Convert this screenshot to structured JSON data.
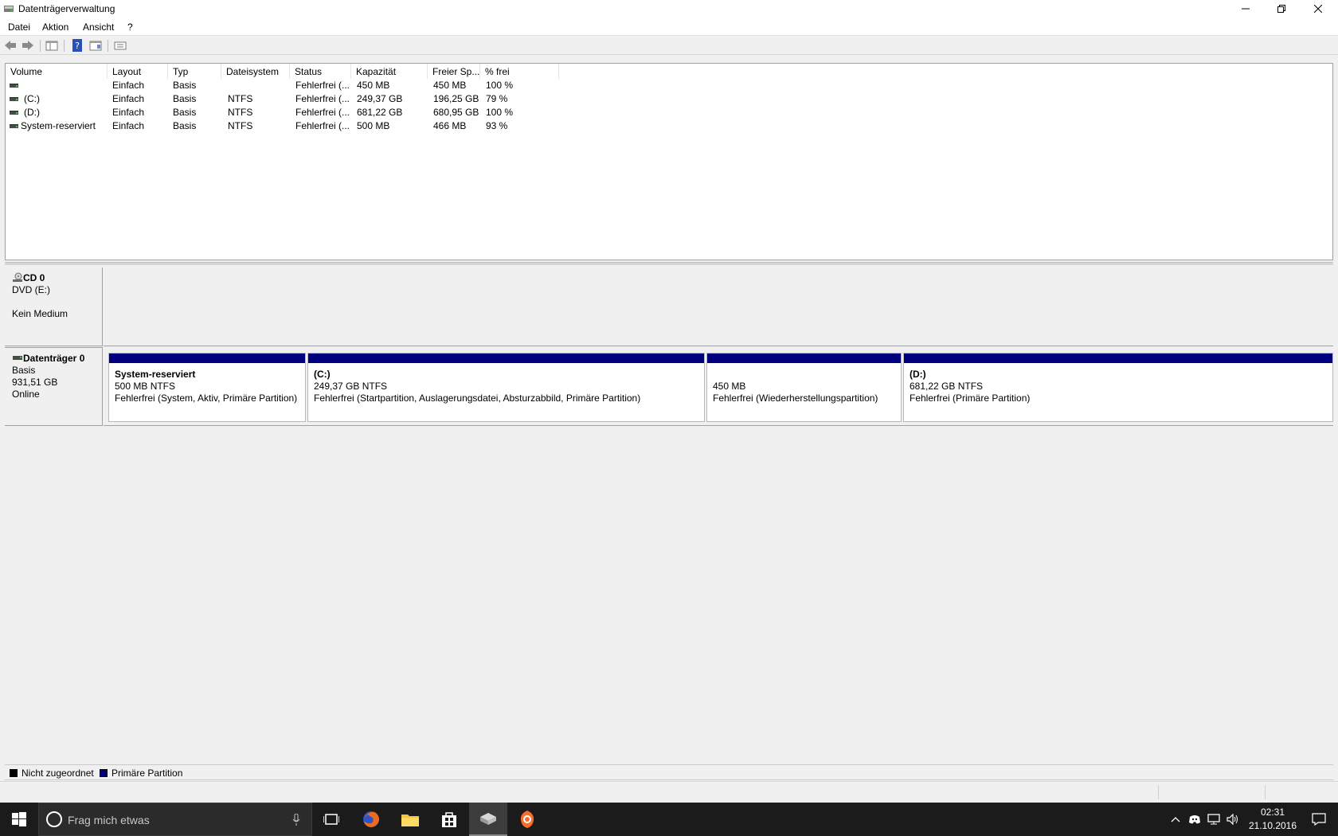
{
  "window": {
    "title": "Datenträgerverwaltung"
  },
  "menu": {
    "items": [
      "Datei",
      "Aktion",
      "Ansicht",
      "?"
    ]
  },
  "toolbar": {
    "buttons": [
      "back-icon",
      "forward-icon",
      "console-tree-icon",
      "help-icon",
      "properties-icon",
      "settings-icon"
    ]
  },
  "volumes": {
    "columns": [
      "Volume",
      "Layout",
      "Typ",
      "Dateisystem",
      "Status",
      "Kapazität",
      "Freier Sp...",
      "% frei"
    ],
    "rows": [
      {
        "volume": "",
        "layout": "Einfach",
        "typ": "Basis",
        "dateisystem": "",
        "status": "Fehlerfrei (...",
        "kapazitaet": "450 MB",
        "frei": "450 MB",
        "prozent": "100 %"
      },
      {
        "volume": "(C:)",
        "layout": "Einfach",
        "typ": "Basis",
        "dateisystem": "NTFS",
        "status": "Fehlerfrei (...",
        "kapazitaet": "249,37 GB",
        "frei": "196,25 GB",
        "prozent": "79 %"
      },
      {
        "volume": "(D:)",
        "layout": "Einfach",
        "typ": "Basis",
        "dateisystem": "NTFS",
        "status": "Fehlerfrei (...",
        "kapazitaet": "681,22 GB",
        "frei": "680,95 GB",
        "prozent": "100 %"
      },
      {
        "volume": "System-reserviert",
        "layout": "Einfach",
        "typ": "Basis",
        "dateisystem": "NTFS",
        "status": "Fehlerfrei (...",
        "kapazitaet": "500 MB",
        "frei": "466 MB",
        "prozent": "93 %"
      }
    ]
  },
  "disks": {
    "cd0": {
      "name": "CD 0",
      "type": "DVD (E:)",
      "status": "Kein Medium"
    },
    "disk0": {
      "name": "Datenträger 0",
      "type": "Basis",
      "size": "931,51 GB",
      "status": "Online",
      "partitions": [
        {
          "title": "System-reserviert",
          "size": "500 MB NTFS",
          "status": "Fehlerfrei (System, Aktiv, Primäre Partition)"
        },
        {
          "title": "(C:)",
          "size": "249,37 GB NTFS",
          "status": "Fehlerfrei (Startpartition, Auslagerungsdatei, Absturzabbild, Primäre Partition)"
        },
        {
          "title": "",
          "size": "450 MB",
          "status": "Fehlerfrei (Wiederherstellungspartition)"
        },
        {
          "title": "(D:)",
          "size": "681,22 GB NTFS",
          "status": "Fehlerfrei (Primäre Partition)"
        }
      ]
    }
  },
  "legend": [
    {
      "label": "Nicht zugeordnet",
      "color": "#000000"
    },
    {
      "label": "Primäre Partition",
      "color": "#00007f"
    }
  ],
  "taskbar": {
    "search_placeholder": "Frag mich etwas",
    "apps": [
      "task-view-icon",
      "firefox-icon",
      "file-explorer-icon",
      "store-icon",
      "disk-management-icon",
      "origin-icon"
    ],
    "clock": {
      "time": "02:31",
      "date": "21.10.2016"
    }
  },
  "colors": {
    "primary_partition": "#00007f",
    "taskbar": "#1b1b1b"
  }
}
